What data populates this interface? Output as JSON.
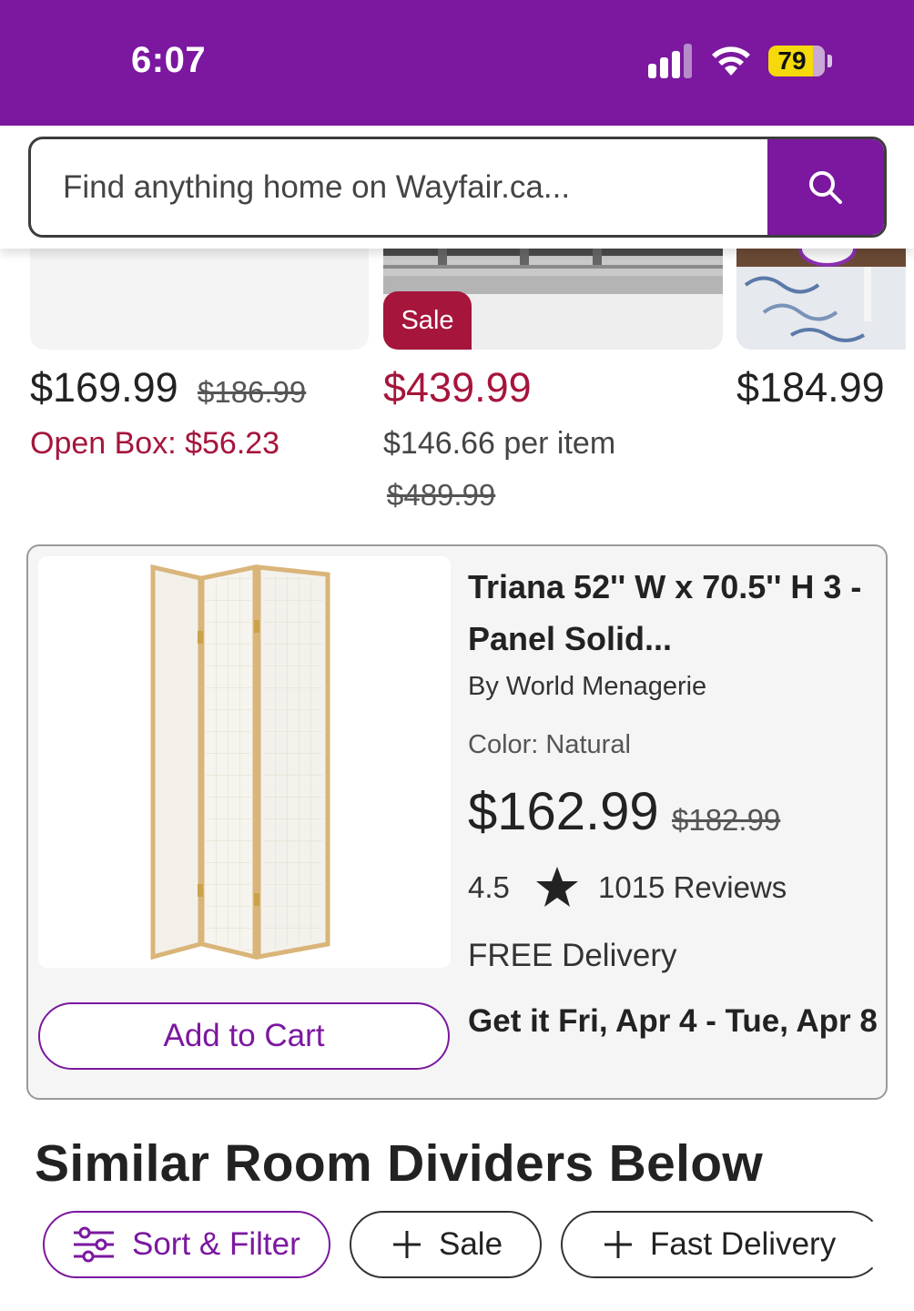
{
  "status_bar": {
    "time": "6:07",
    "battery": "79",
    "icons": [
      "signal-icon",
      "wifi-icon",
      "battery-icon"
    ]
  },
  "search": {
    "placeholder": "Find anything home on Wayfair.ca...",
    "icon": "search-icon"
  },
  "carousel": {
    "items": [
      {
        "price": "$169.99",
        "old_price": "$186.99",
        "open_box": "Open Box: $56.23"
      },
      {
        "badge": "Sale",
        "price": "$439.99",
        "per_item": "$146.66 per item",
        "old_price": "$489.99"
      },
      {
        "price": "$184.99"
      }
    ]
  },
  "product": {
    "title": "Triana 52'' W x 70.5'' H 3 - Panel Solid...",
    "brand": "By World Menagerie",
    "color": "Color: Natural",
    "price": "$162.99",
    "old_price": "$182.99",
    "rating": "4.5",
    "rating_icon": "star-icon",
    "reviews": "1015 Reviews",
    "delivery": "FREE Delivery",
    "get_it": "Get it Fri, Apr 4 - Tue, Apr 8",
    "add_to_cart": "Add to Cart"
  },
  "section": {
    "title": "Similar Room Dividers Below"
  },
  "filters": {
    "sort_filter": "Sort & Filter",
    "sale": "Sale",
    "fast_delivery": "Fast Delivery"
  },
  "colors": {
    "brand_purple": "#7b189f",
    "sale_red": "#a6153c"
  }
}
